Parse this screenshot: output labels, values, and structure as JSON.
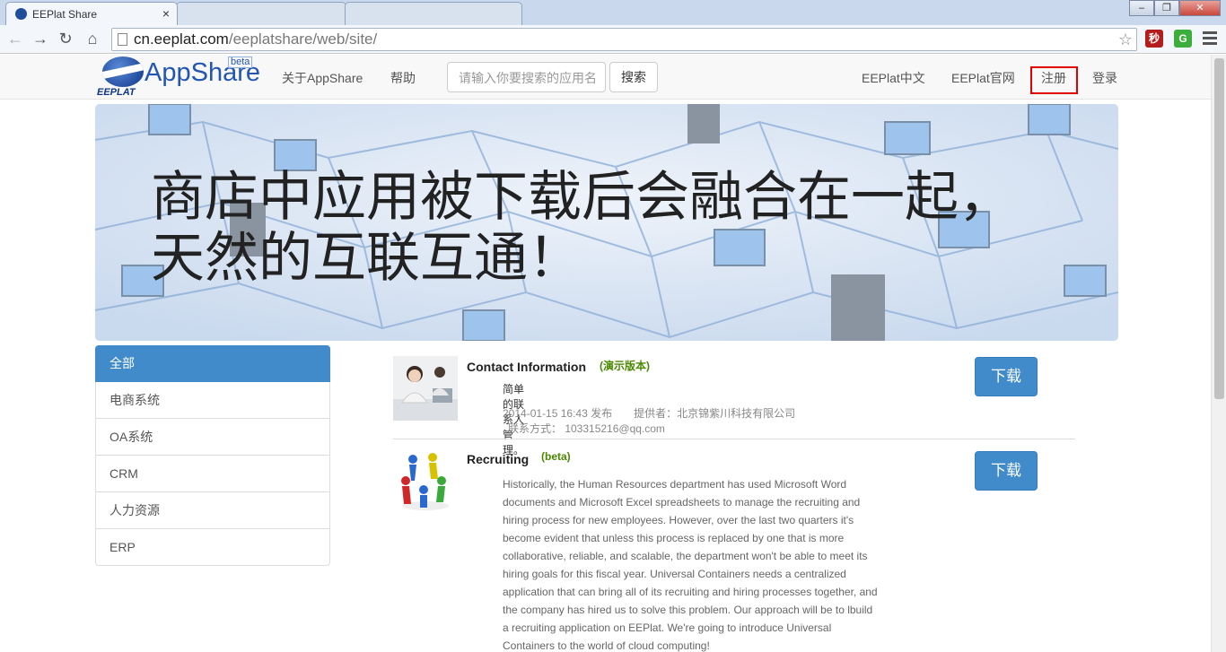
{
  "browser": {
    "tab_title": "EEPlat Share",
    "tab_close": "×",
    "url_host": "cn.eeplat.com",
    "url_path": "/eeplatshare/web/site/",
    "ext1_label": "秒",
    "ext2_label": "G"
  },
  "header": {
    "logo_text": "AppShare",
    "logo_badge": "beta",
    "logo_sub": "EEPLAT",
    "nav_about": "关于AppShare",
    "nav_help": "帮助",
    "search_placeholder": "请输入你要搜索的应用名",
    "search_button": "搜索",
    "nav_eeplat_cn": "EEPlat中文",
    "nav_eeplat_site": "EEPlat官网",
    "nav_register": "注册",
    "nav_login": "登录"
  },
  "banner": {
    "line1": "商店中应用被下载后会融合在一起，",
    "line2": "天然的互联互通！"
  },
  "sidebar": {
    "items": [
      {
        "label": "全部"
      },
      {
        "label": "电商系统"
      },
      {
        "label": "OA系统"
      },
      {
        "label": "CRM"
      },
      {
        "label": "人力资源"
      },
      {
        "label": "ERP"
      }
    ]
  },
  "apps": [
    {
      "name": "Contact Information",
      "tag": "(演示版本)",
      "desc": "简单的联系人管理。",
      "published": "2014-01-15 16:43 发布",
      "provider": "提供者：北京锦紫川科技有限公司",
      "contact": "联系方式：   103315216@qq.com",
      "download": "下载"
    },
    {
      "name": "Recruiting",
      "tag": "(beta)",
      "desc": "Historically, the Human Resources department has used Microsoft Word documents and Microsoft Excel spreadsheets to manage the recruiting and hiring process for new employees. However, over the last two quarters it's become evident that unless this process is replaced by one that is more collaborative, reliable, and scalable, the department won't be able to meet its hiring goals for this fiscal year. Universal Containers needs a centralized application that can bring all of its recruiting and hiring processes together, and the company has hired us to solve this problem. Our approach will be to lbuild a recruiting application on EEPlat. We're going to introduce Universal Containers to the world of cloud computing!",
      "download": "下载"
    }
  ]
}
